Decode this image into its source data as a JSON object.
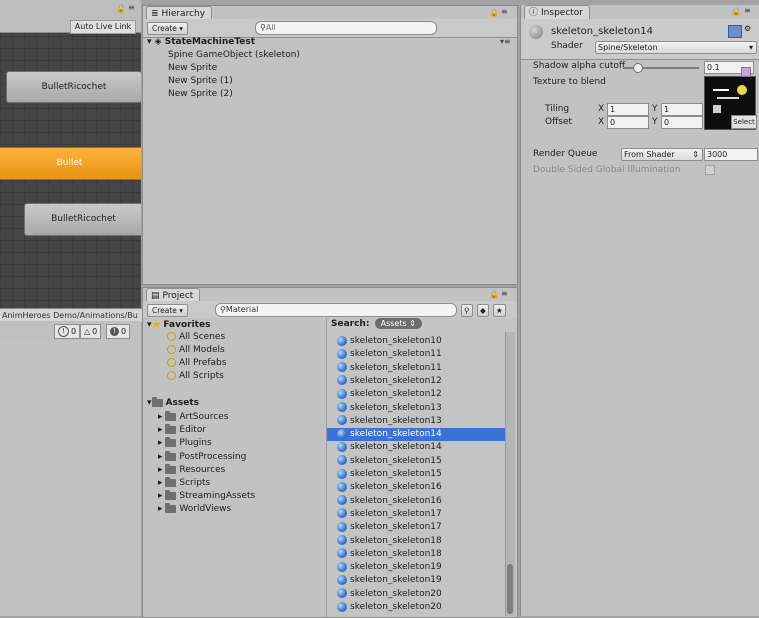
{
  "animator": {
    "auto_live_link": "Auto Live Link",
    "nodes": [
      "BulletRicochet",
      "Bullet",
      "BulletRicochet"
    ],
    "path": "AnimHeroes Demo/Animations/Bu",
    "console_counts": [
      "0",
      "0",
      "0"
    ]
  },
  "hierarchy": {
    "tab": "Hierarchy",
    "create": "Create",
    "search_placeholder": "All",
    "scene": "StateMachineTest",
    "items": [
      "Spine GameObject (skeleton)",
      "New Sprite",
      "New Sprite (1)",
      "New Sprite (2)"
    ]
  },
  "project": {
    "tab": "Project",
    "create": "Create",
    "search_value": "Material",
    "favorites": {
      "label": "Favorites",
      "items": [
        "All Scenes",
        "All Models",
        "All Prefabs",
        "All Scripts"
      ]
    },
    "assets": {
      "label": "Assets",
      "folders": [
        "ArtSources",
        "Editor",
        "Plugins",
        "PostProcessing",
        "Resources",
        "Scripts",
        "StreamingAssets",
        "WorldViews"
      ]
    },
    "search_label": "Search:",
    "search_scope": "Assets",
    "results": [
      "skeleton_skeleton10",
      "skeleton_skeleton11",
      "skeleton_skeleton11",
      "skeleton_skeleton12",
      "skeleton_skeleton12",
      "skeleton_skeleton13",
      "skeleton_skeleton13",
      "skeleton_skeleton14",
      "skeleton_skeleton14",
      "skeleton_skeleton15",
      "skeleton_skeleton15",
      "skeleton_skeleton16",
      "skeleton_skeleton16",
      "skeleton_skeleton17",
      "skeleton_skeleton17",
      "skeleton_skeleton18",
      "skeleton_skeleton18",
      "skeleton_skeleton19",
      "skeleton_skeleton19",
      "skeleton_skeleton20",
      "skeleton_skeleton20"
    ],
    "selected_index": 7,
    "selection_color": "#3a72d8"
  },
  "inspector": {
    "tab": "Inspector",
    "material_name": "skeleton_skeleton14",
    "shader_label": "Shader",
    "shader_value": "Spine/Skeleton",
    "shadow_label": "Shadow alpha cutoff",
    "shadow_value": "0.1",
    "texture_label": "Texture to blend",
    "tiling_label": "Tiling",
    "offset_label": "Offset",
    "tiling_x": "1",
    "tiling_y": "1",
    "offset_x": "0",
    "offset_y": "0",
    "x_label": "X",
    "y_label": "Y",
    "select_label": "Select",
    "render_queue_label": "Render Queue",
    "render_queue_mode": "From Shader",
    "render_queue_value": "3000",
    "gi_label": "Double Sided Global Illumination"
  },
  "colors": {
    "accent_orange": "#f0a020",
    "selection": "#3a72d8"
  }
}
